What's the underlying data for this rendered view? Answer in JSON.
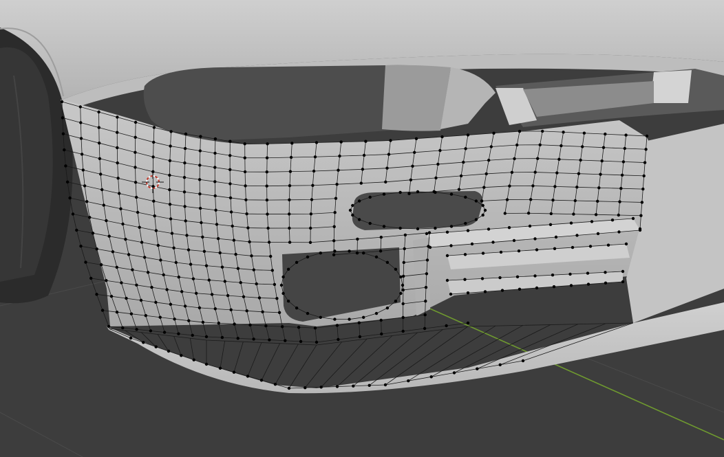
{
  "viewport": {
    "mode": "edit-mode-mesh",
    "background_color": "#3d3d3d",
    "grid_line_color": "#505050",
    "x_axis_color": "#6f9a2f",
    "mesh_color": "#b9b9b9",
    "cursor_color": "#c0392b",
    "icons": [
      "3d-cursor-icon"
    ]
  }
}
